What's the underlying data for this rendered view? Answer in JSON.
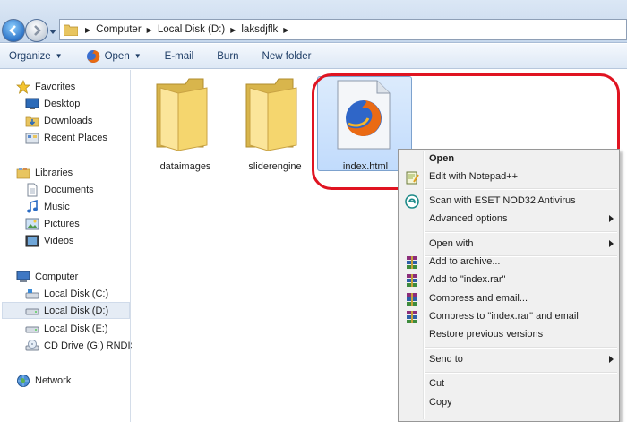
{
  "address": {
    "crumbs": [
      "Computer",
      "Local Disk (D:)",
      "laksdjflk"
    ]
  },
  "toolbar": {
    "organize": "Organize",
    "open": "Open",
    "email": "E-mail",
    "burn": "Burn",
    "new_folder": "New folder"
  },
  "nav": {
    "favorites": {
      "title": "Favorites",
      "items": [
        "Desktop",
        "Downloads",
        "Recent Places"
      ]
    },
    "libraries": {
      "title": "Libraries",
      "items": [
        "Documents",
        "Music",
        "Pictures",
        "Videos"
      ]
    },
    "computer": {
      "title": "Computer",
      "items": [
        "Local Disk (C:)",
        "Local Disk (D:)",
        "Local Disk (E:)",
        "CD Drive (G:) RNDIS"
      ]
    },
    "network": {
      "title": "Network"
    }
  },
  "files": [
    {
      "name": "dataimages",
      "kind": "folder"
    },
    {
      "name": "sliderengine",
      "kind": "folder"
    },
    {
      "name": "index.html",
      "kind": "html",
      "selected": true
    }
  ],
  "context_menu": {
    "open": "Open",
    "edit_notepad": "Edit with Notepad++",
    "eset": "Scan with ESET NOD32 Antivirus",
    "advanced": "Advanced options",
    "open_with": "Open with",
    "add_archive": "Add to archive...",
    "add_rar": "Add to \"index.rar\"",
    "compress_email": "Compress and email...",
    "compress_rar_email": "Compress to \"index.rar\" and email",
    "restore": "Restore previous versions",
    "send_to": "Send to",
    "cut": "Cut",
    "copy": "Copy"
  },
  "colors": {
    "highlight_circle": "#e01421",
    "selection": "#c1dbfc",
    "toolbar_text": "#1e3d66"
  }
}
